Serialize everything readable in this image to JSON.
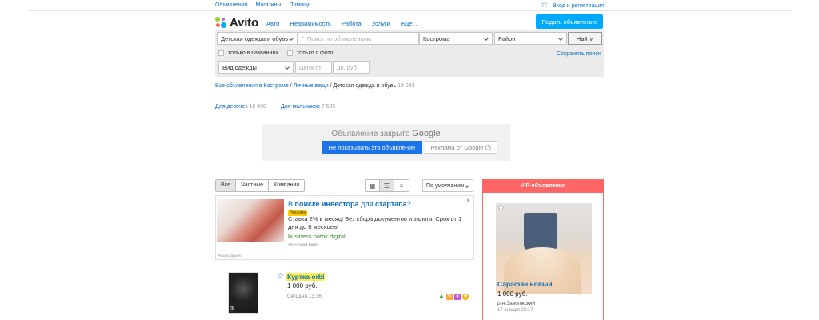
{
  "topbar": {
    "links": [
      "Объявления",
      "Магазины",
      "Помощь"
    ],
    "login": "Вход и регистрация"
  },
  "header": {
    "logo": "Avito",
    "nav": [
      "Авто",
      "Недвижимость",
      "Работа",
      "Услуги",
      "ещё..."
    ],
    "post_button": "Подать объявление"
  },
  "search": {
    "category": "Детская одежда и обувь",
    "query_placeholder": "Поиск по объявлениям",
    "city": "Кострома",
    "district": "Район",
    "find_button": "Найти",
    "only_titles": "только в названиях",
    "only_photo": "только с фото",
    "save_search": "Сохранить поиск",
    "clothing_type": "Вид одежды",
    "price_from": "Цена от",
    "price_to": "до, руб"
  },
  "breadcrumb": {
    "part1": "Все объявления в Костроме",
    "sep": " / ",
    "part2": "Личные вещи",
    "current": "Детская одежда и обувь",
    "count": "18 033"
  },
  "subcats": [
    {
      "label": "Для девочек",
      "count": "10 498"
    },
    {
      "label": "Для мальчиков",
      "count": "7 535"
    }
  ],
  "google_closed": {
    "text": "Объявление закрыто",
    "brand": "Google",
    "hide_button": "Не показывать это объявление",
    "ads_by": "Реклама от Google"
  },
  "filters": {
    "segments": [
      "Все",
      "Частные",
      "Компании"
    ],
    "sort": "По умолчанию"
  },
  "yandex_ad": {
    "title_pre": "В ",
    "title_bold1": "поиске инвестора",
    "title_mid": " для ",
    "title_bold2": "стартапа",
    "title_end": "?",
    "badge": "Реклама",
    "text": "Ставка 2% в месяц! Без сбора документов и залога! Срок от 1 дня до 6 месяцев!",
    "domain": "business.potok.digital",
    "legal": "АО «Альфа-Банк»",
    "source": "Яндекс.Директ",
    "close": "×"
  },
  "listing": {
    "title": "Куртка orbi",
    "price": "1 000 руб.",
    "date": "Сегодня 13:36",
    "photo_count": "3"
  },
  "vip": {
    "header": "VIP-объявления",
    "title": "Сарафан новый",
    "price": "1 000 руб.",
    "location": "р-н Заволжский",
    "date": "17 января 23:17"
  },
  "colors": {
    "link": "#0a6fc2",
    "post_button": "#00aaff",
    "vip": "#ff6666",
    "highlight": "#ffef4a"
  }
}
